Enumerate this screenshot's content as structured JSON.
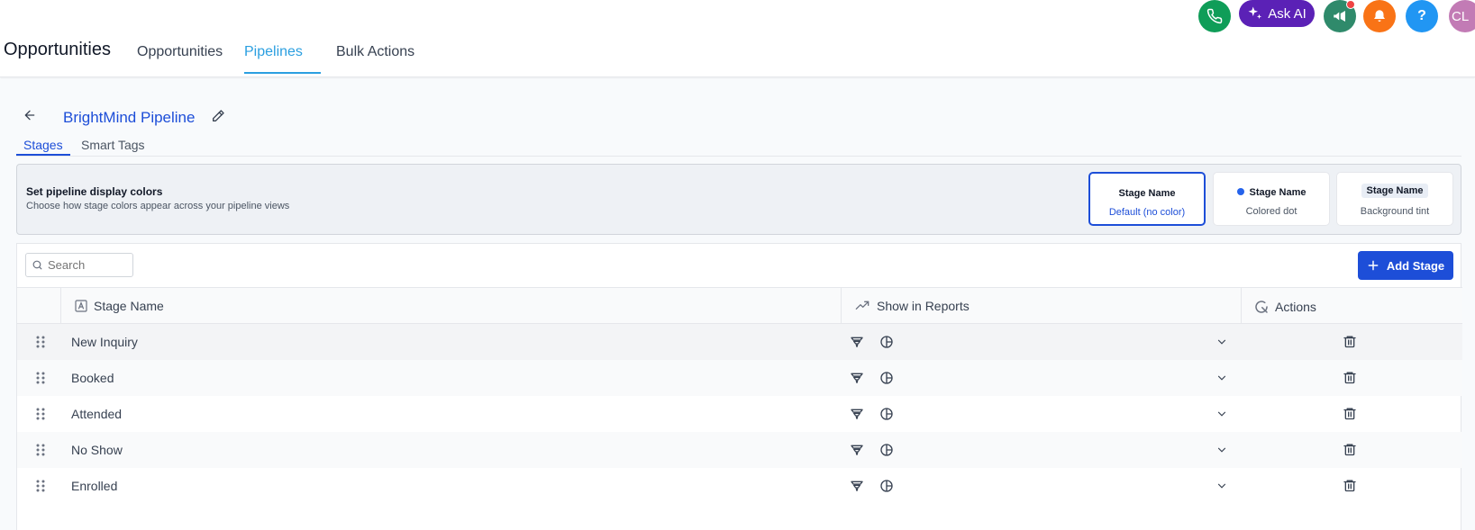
{
  "header": {
    "app_title": "Opportunities",
    "tabs": [
      {
        "label": "Opportunities",
        "active": false
      },
      {
        "label": "Pipelines",
        "active": true
      },
      {
        "label": "Bulk Actions",
        "active": false
      }
    ],
    "ask_ai_label": "Ask AI",
    "help_label": "?",
    "avatar_initials": "CL",
    "icons": [
      "phone-icon",
      "sparkle-icon",
      "megaphone-icon",
      "bell-icon",
      "help-icon"
    ]
  },
  "pipeline": {
    "title": "BrightMind Pipeline",
    "subtabs": [
      {
        "label": "Stages",
        "active": true
      },
      {
        "label": "Smart Tags",
        "active": false
      }
    ]
  },
  "display_colors": {
    "title": "Set pipeline display colors",
    "description": "Choose how stage colors appear across your pipeline views",
    "options": [
      {
        "name": "Stage Name",
        "label": "Default (no color)",
        "selected": true
      },
      {
        "name": "Stage Name",
        "label": "Colored dot",
        "selected": false
      },
      {
        "name": "Stage Name",
        "label": "Background tint",
        "selected": false
      }
    ]
  },
  "table": {
    "search_placeholder": "Search",
    "add_label": "Add Stage",
    "columns": [
      "Stage Name",
      "Show in Reports",
      "Actions"
    ],
    "rows": [
      {
        "name": "New Inquiry"
      },
      {
        "name": "Booked"
      },
      {
        "name": "Attended"
      },
      {
        "name": "No Show"
      },
      {
        "name": "Enrolled"
      }
    ]
  },
  "colors": {
    "accent": "#1d4ed8",
    "tab_active": "#2b9fe0",
    "phone": "#0f9d58",
    "ask_ai": "#5b21b6",
    "megaphone": "#2f8a6b",
    "bell": "#f97316",
    "help": "#2196f3",
    "avatar": "#c27bb5",
    "notification_dot": "#ef4444"
  }
}
